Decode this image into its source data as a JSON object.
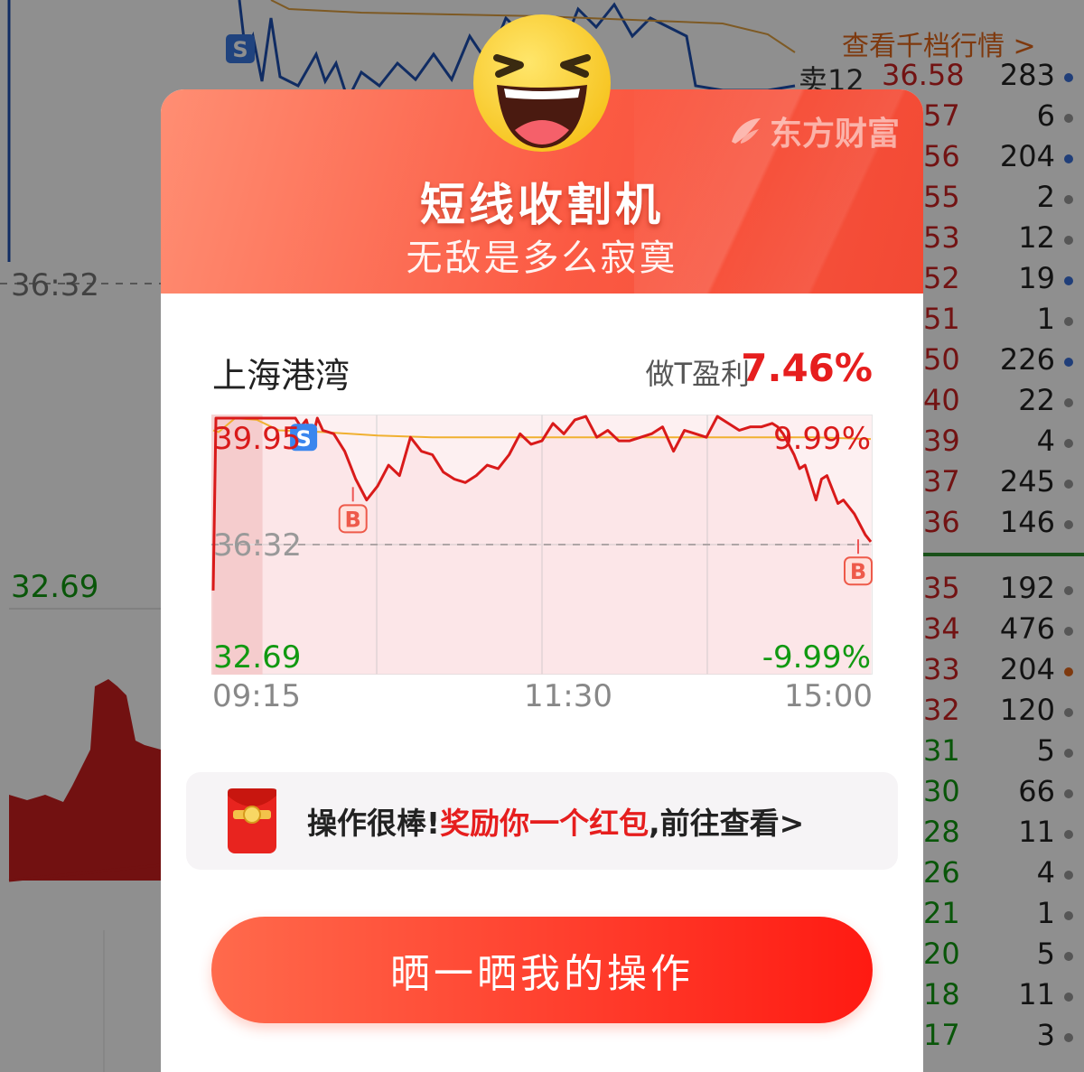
{
  "background": {
    "chart_ref_price": "36:32",
    "chart_low_price": "32.69",
    "orderbook_link": "查看千档行情 >",
    "orderbook_header_label": "卖12",
    "orderbook": [
      {
        "label": "卖12",
        "price": "36.58",
        "volume": "283",
        "side": "sell",
        "dot": "#3a6fd8"
      },
      {
        "label": "",
        "price": "57",
        "volume": "6",
        "side": "sell",
        "dot": "#999999"
      },
      {
        "label": "",
        "price": "56",
        "volume": "204",
        "side": "sell",
        "dot": "#3a6fd8"
      },
      {
        "label": "",
        "price": "55",
        "volume": "2",
        "side": "sell",
        "dot": "#999999"
      },
      {
        "label": "",
        "price": "53",
        "volume": "12",
        "side": "sell",
        "dot": "#999999"
      },
      {
        "label": "",
        "price": "52",
        "volume": "19",
        "side": "sell",
        "dot": "#3a6fd8"
      },
      {
        "label": "",
        "price": "51",
        "volume": "1",
        "side": "sell",
        "dot": "#999999"
      },
      {
        "label": "",
        "price": "50",
        "volume": "226",
        "side": "sell",
        "dot": "#3a6fd8"
      },
      {
        "label": "",
        "price": "40",
        "volume": "22",
        "side": "sell",
        "dot": "#999999"
      },
      {
        "label": "",
        "price": "39",
        "volume": "4",
        "side": "sell",
        "dot": "#999999"
      },
      {
        "label": "",
        "price": "37",
        "volume": "245",
        "side": "sell",
        "dot": "#999999"
      },
      {
        "label": "",
        "price": "36",
        "volume": "146",
        "side": "sell",
        "dot": "#999999"
      },
      {
        "label": "",
        "price": "35",
        "volume": "192",
        "side": "neutral",
        "dot": "#999999"
      },
      {
        "label": "",
        "price": "34",
        "volume": "476",
        "side": "neutral",
        "dot": "#999999"
      },
      {
        "label": "",
        "price": "33",
        "volume": "204",
        "side": "neutral",
        "dot": "#e0661a"
      },
      {
        "label": "",
        "price": "32",
        "volume": "120",
        "side": "neutral",
        "dot": "#999999"
      },
      {
        "label": "",
        "price": "31",
        "volume": "5",
        "side": "buy",
        "dot": "#999999"
      },
      {
        "label": "",
        "price": "30",
        "volume": "66",
        "side": "buy",
        "dot": "#999999"
      },
      {
        "label": "",
        "price": "28",
        "volume": "11",
        "side": "buy",
        "dot": "#999999"
      },
      {
        "label": "",
        "price": "26",
        "volume": "4",
        "side": "buy",
        "dot": "#999999"
      },
      {
        "label": "",
        "price": "21",
        "volume": "1",
        "side": "buy",
        "dot": "#999999"
      },
      {
        "label": "",
        "price": "20",
        "volume": "5",
        "side": "buy",
        "dot": "#999999"
      },
      {
        "label": "",
        "price": "18",
        "volume": "11",
        "side": "buy",
        "dot": "#999999"
      },
      {
        "label": "",
        "price": "17",
        "volume": "3",
        "side": "buy",
        "dot": "#999999"
      }
    ]
  },
  "modal": {
    "brand": "东方财富",
    "title": "短线收割机",
    "subtitle": "无敌是多么寂寞",
    "stock_name": "上海港湾",
    "profit_label": "做T盈利",
    "profit_value": "7.46%",
    "reward_prefix": "操作很棒!",
    "reward_highlight": "奖励你一个红包",
    "reward_suffix": ",前往查看>",
    "share_button": "晒一晒我的操作",
    "colors": {
      "accent": "#f24934",
      "up": "#e61e1e",
      "down": "#119911",
      "avg_line": "#f0b030"
    }
  },
  "chart_data": {
    "type": "line",
    "title": "",
    "y_high_label": "39.95",
    "y_ref_label": "36.32",
    "y_low_label": "32.69",
    "pct_high_label": "9.99%",
    "pct_low_label": "-9.99%",
    "ylim": [
      32.69,
      39.95
    ],
    "ref_price": 36.32,
    "x_ticks": [
      "09:15",
      "11:30",
      "15:00"
    ],
    "xlim": [
      0,
      240
    ],
    "series": [
      {
        "x": [
          0,
          1,
          2,
          3,
          8,
          12,
          14,
          16,
          18,
          20,
          22,
          24,
          26,
          28,
          30,
          32,
          34,
          36,
          38,
          40,
          44,
          48,
          52,
          56,
          60,
          64,
          68,
          72,
          76,
          80,
          84,
          88,
          92,
          96,
          100,
          104,
          108,
          112,
          116,
          120,
          124,
          128,
          132,
          136,
          140,
          144,
          148,
          152,
          156,
          160,
          164,
          168,
          172,
          176,
          180,
          184,
          188,
          192,
          196,
          200,
          204,
          206,
          208,
          210,
          212,
          214,
          216,
          218,
          220,
          222,
          224,
          226,
          228,
          230,
          232,
          234,
          236,
          238,
          240
        ],
        "y": [
          35.0,
          39.95,
          39.95,
          39.95,
          39.95,
          39.95,
          39.95,
          39.95,
          39.95,
          39.95,
          39.95,
          39.95,
          39.95,
          39.95,
          39.95,
          39.7,
          39.9,
          39.3,
          39.95,
          39.6,
          39.5,
          39.0,
          38.2,
          37.6,
          38.0,
          38.6,
          38.3,
          39.4,
          39.0,
          38.9,
          38.4,
          38.2,
          38.1,
          38.3,
          38.6,
          38.5,
          38.9,
          39.5,
          39.2,
          39.3,
          39.8,
          39.5,
          39.9,
          40.0,
          39.4,
          39.6,
          39.3,
          39.3,
          39.4,
          39.5,
          39.7,
          39.0,
          39.6,
          39.5,
          39.4,
          40.0,
          39.8,
          39.6,
          39.7,
          39.7,
          39.8,
          39.7,
          39.5,
          39.2,
          38.9,
          38.5,
          38.6,
          38.1,
          37.6,
          38.2,
          38.3,
          37.9,
          37.5,
          37.6,
          37.4,
          37.2,
          36.9,
          36.6,
          36.4
        ]
      },
      {
        "x": [
          0,
          2,
          8,
          16,
          24,
          40,
          60,
          80,
          100,
          120,
          140,
          160,
          180,
          200,
          220,
          240
        ],
        "y": [
          39.6,
          39.55,
          39.95,
          39.9,
          39.6,
          39.55,
          39.45,
          39.4,
          39.4,
          39.4,
          39.4,
          39.4,
          39.4,
          39.4,
          39.4,
          39.35
        ]
      }
    ],
    "markers": [
      {
        "label": "S",
        "x": 33,
        "y": 39.4
      },
      {
        "label": "B",
        "x": 51,
        "y": 37.4
      },
      {
        "label": "B",
        "x": 239,
        "y": 35.9
      }
    ]
  }
}
